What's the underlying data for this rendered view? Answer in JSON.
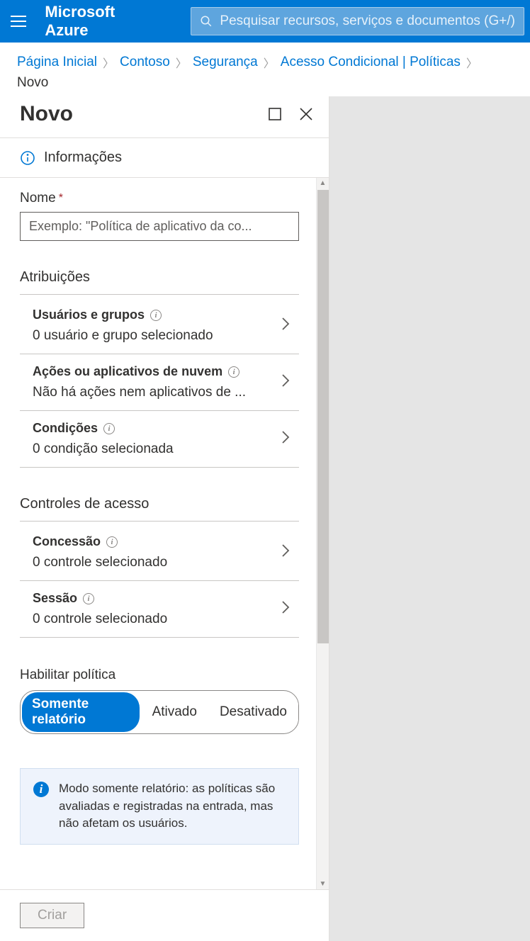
{
  "header": {
    "brand": "Microsoft Azure",
    "search_placeholder": "Pesquisar recursos, serviços e documentos (G+/)"
  },
  "breadcrumb": {
    "items": [
      "Página Inicial",
      "Contoso",
      "Segurança",
      "Acesso Condicional | Políticas"
    ],
    "current": "Novo"
  },
  "blade": {
    "title": "Novo",
    "info_label": "Informações",
    "name": {
      "label": "Nome",
      "placeholder": "Exemplo: \"Política de aplicativo da co..."
    },
    "assignments": {
      "header": "Atribuições",
      "items": [
        {
          "title": "Usuários e grupos",
          "sub": "0 usuário e grupo selecionado"
        },
        {
          "title": "Ações ou aplicativos de nuvem",
          "sub": "Não há ações nem aplicativos de ..."
        },
        {
          "title": "Condições",
          "sub": "0 condição selecionada"
        }
      ]
    },
    "access_controls": {
      "header": "Controles de acesso",
      "items": [
        {
          "title": "Concessão",
          "sub": "0 controle selecionado"
        },
        {
          "title": "Sessão",
          "sub": "0 controle selecionado"
        }
      ]
    },
    "enable_policy": {
      "label": "Habilitar política",
      "options": [
        "Somente relatório",
        "Ativado",
        "Desativado"
      ],
      "selected": 0
    },
    "info_box": "Modo somente relatório: as políticas são avaliadas e registradas na entrada, mas não afetam os usuários.",
    "create_button": "Criar"
  }
}
